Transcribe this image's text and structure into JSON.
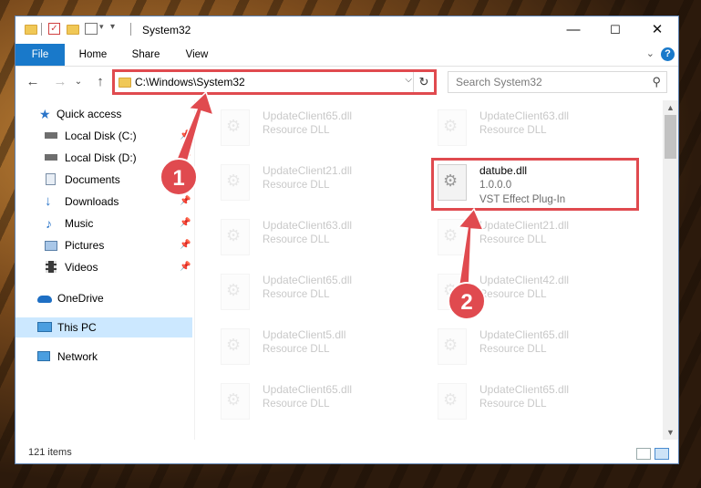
{
  "window": {
    "title": "System32",
    "buttons": {
      "minimize": "—",
      "maximize": "☐",
      "close": "✕"
    }
  },
  "ribbon": {
    "tabs": [
      "File",
      "Home",
      "Share",
      "View"
    ],
    "help": "?",
    "expand": "⌄"
  },
  "address": {
    "path": "C:\\Windows\\System32",
    "dropdown": "⌵",
    "refresh": "↻"
  },
  "search": {
    "placeholder": "Search System32",
    "icon": "search-icon"
  },
  "nav": {
    "back": "←",
    "forward": "→",
    "recent": "⌄",
    "up": "↑"
  },
  "navpane": {
    "items": [
      {
        "label": "Quick access",
        "icon": "star-icon",
        "pinned": false
      },
      {
        "label": "Local Disk (C:)",
        "icon": "drive-icon",
        "pinned": true
      },
      {
        "label": "Local Disk (D:)",
        "icon": "drive-icon",
        "pinned": true
      },
      {
        "label": "Documents",
        "icon": "documents-icon",
        "pinned": true
      },
      {
        "label": "Downloads",
        "icon": "downloads-icon",
        "pinned": true
      },
      {
        "label": "Music",
        "icon": "music-icon",
        "pinned": true
      },
      {
        "label": "Pictures",
        "icon": "pictures-icon",
        "pinned": true
      },
      {
        "label": "Videos",
        "icon": "videos-icon",
        "pinned": true
      },
      {
        "label": "OneDrive",
        "icon": "onedrive-icon",
        "pinned": false
      },
      {
        "label": "This PC",
        "icon": "pc-icon",
        "pinned": false
      },
      {
        "label": "Network",
        "icon": "network-icon",
        "pinned": false
      }
    ],
    "pin_glyph": "📌"
  },
  "files": {
    "left_column": [
      {
        "name": "UpdateClient65.dll",
        "type": "Resource DLL"
      },
      {
        "name": "UpdateClient21.dll",
        "type": "Resource DLL"
      },
      {
        "name": "UpdateClient63.dll",
        "type": "Resource DLL"
      },
      {
        "name": "UpdateClient65.dll",
        "type": "Resource DLL"
      },
      {
        "name": "UpdateClient5.dll",
        "type": "Resource DLL"
      },
      {
        "name": "UpdateClient65.dll",
        "type": "Resource DLL"
      }
    ],
    "right_column": [
      {
        "name": "UpdateClient63.dll",
        "type": "Resource DLL"
      },
      {
        "name": "datube.dll",
        "version": "1.0.0.0",
        "type": "VST Effect Plug-In",
        "highlighted": true
      },
      {
        "name": "UpdateClient21.dll",
        "type": "Resource DLL"
      },
      {
        "name": "UpdateClient42.dll",
        "type": "Resource DLL"
      },
      {
        "name": "UpdateClient65.dll",
        "type": "Resource DLL"
      },
      {
        "name": "UpdateClient65.dll",
        "type": "Resource DLL"
      }
    ]
  },
  "status": {
    "count": "121 items"
  },
  "callouts": {
    "one": "1",
    "two": "2",
    "color": "#e04a4f"
  },
  "colors": {
    "file_tab": "#1979ca",
    "selected_nav": "#cce8ff",
    "highlight": "#e04a4f"
  }
}
